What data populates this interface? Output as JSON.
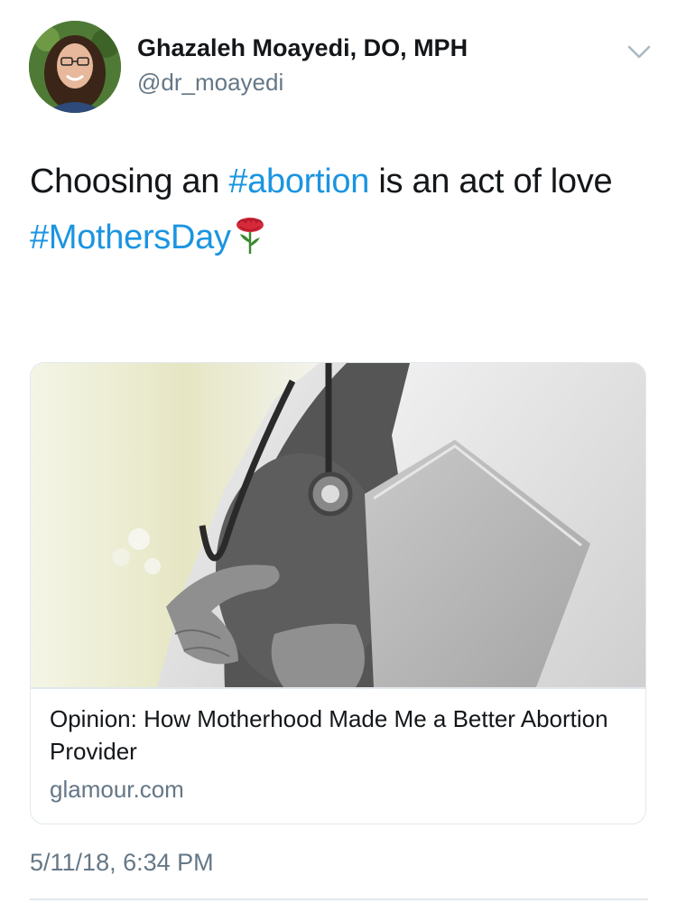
{
  "author": {
    "name": "Ghazaleh Moayedi, DO, MPH",
    "handle": "@dr_moayedi"
  },
  "tweet": {
    "text_before": "Choosing an ",
    "hashtag_1": "#abortion",
    "text_after": " is an act of love",
    "hashtag_2": "#MothersDay",
    "emoji": "rose-icon"
  },
  "card": {
    "title": "Opinion: How Motherhood Made Me a Better Abortion Provider",
    "domain": "glamour.com"
  },
  "timestamp": "5/11/18, 6:34 PM",
  "colors": {
    "hashtag": "#1b95e0",
    "secondary_text": "#657786",
    "border": "#e1e8ed"
  }
}
